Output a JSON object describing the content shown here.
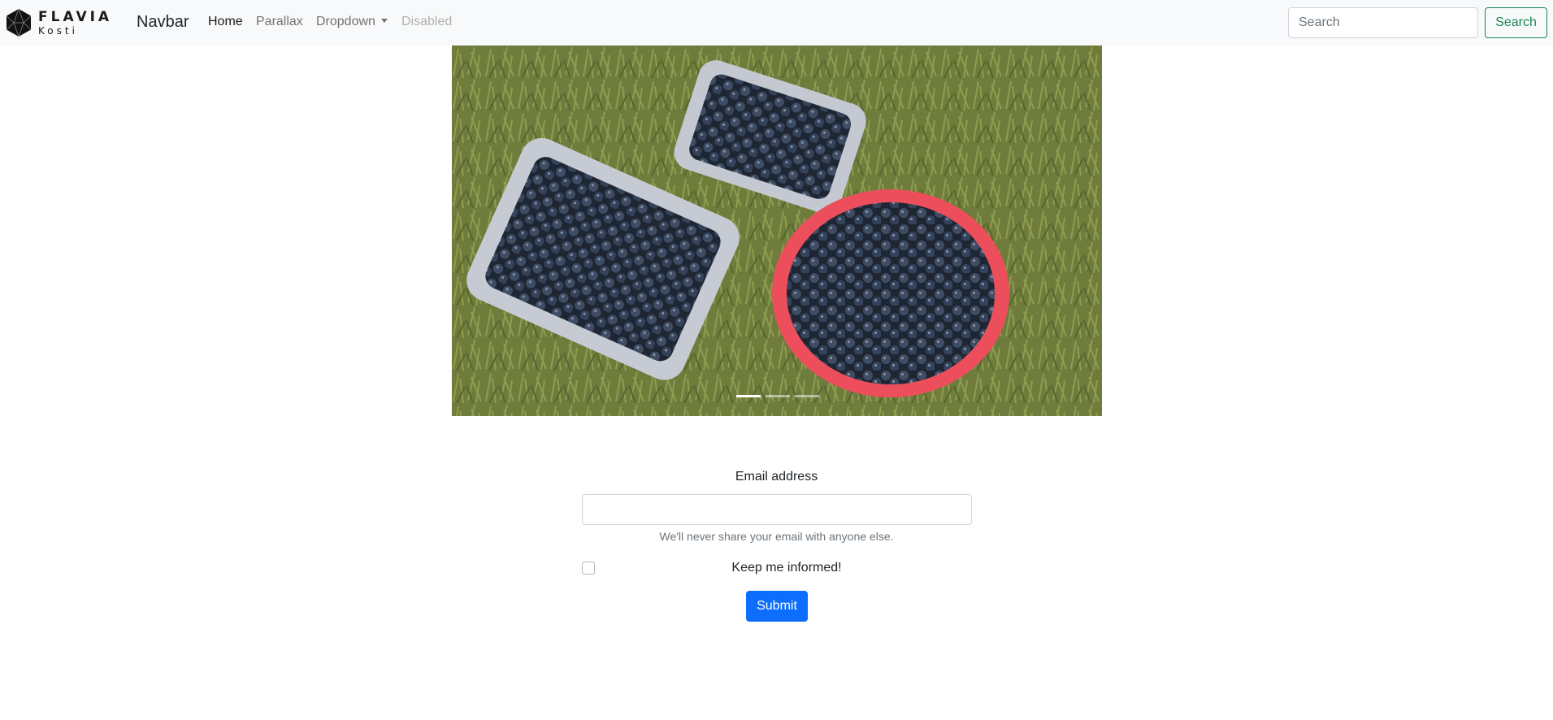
{
  "navbar": {
    "brand_top": "FLAVIA",
    "brand_bottom": "Kosti",
    "title": "Navbar",
    "links": [
      "Home",
      "Parallax",
      "Dropdown",
      "Disabled"
    ],
    "search_placeholder": "Search",
    "search_button": "Search",
    "link_color": "#212529",
    "success_color": "#198754"
  },
  "carousel": {
    "slide_count": 3,
    "active_index": 0
  },
  "form": {
    "email_label": "Email address",
    "email_value": "",
    "email_help": "We'll never share your email with anyone else.",
    "checkbox_label": "Keep me informed!",
    "checkbox_checked": false,
    "submit_label": "Submit",
    "primary_color": "#0d6efd"
  }
}
